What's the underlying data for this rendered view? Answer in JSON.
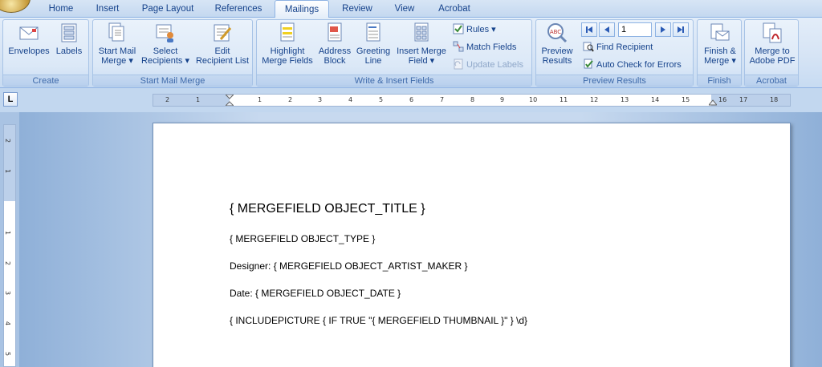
{
  "tabs": [
    "Home",
    "Insert",
    "Page Layout",
    "References",
    "Mailings",
    "Review",
    "View",
    "Acrobat"
  ],
  "active_tab": "Mailings",
  "ribbon": {
    "create": {
      "label": "Create",
      "envelopes": "Envelopes",
      "labels": "Labels"
    },
    "start_mail_merge": {
      "label": "Start Mail Merge",
      "start_l1": "Start Mail",
      "start_l2": "Merge ▾",
      "select_l1": "Select",
      "select_l2": "Recipients ▾",
      "edit_l1": "Edit",
      "edit_l2": "Recipient List"
    },
    "write_insert": {
      "label": "Write & Insert Fields",
      "highlight_l1": "Highlight",
      "highlight_l2": "Merge Fields",
      "address_l1": "Address",
      "address_l2": "Block",
      "greeting_l1": "Greeting",
      "greeting_l2": "Line",
      "insert_l1": "Insert Merge",
      "insert_l2": "Field ▾",
      "rules": "Rules ▾",
      "match_fields": "Match Fields",
      "update_labels": "Update Labels"
    },
    "preview": {
      "label": "Preview Results",
      "preview_l1": "Preview",
      "preview_l2": "Results",
      "record_value": "1",
      "find_recipient": "Find Recipient",
      "auto_check": "Auto Check for Errors"
    },
    "finish": {
      "label": "Finish",
      "finish_l1": "Finish &",
      "finish_l2": "Merge ▾"
    },
    "acrobat": {
      "label": "Acrobat",
      "merge_l1": "Merge to",
      "merge_l2": "Adobe PDF"
    }
  },
  "ruler": {
    "tab_selector": "L",
    "h_ticks": [
      "2",
      "1",
      "1",
      "2",
      "3",
      "4",
      "5",
      "6",
      "7",
      "8",
      "9",
      "10",
      "11",
      "12",
      "13",
      "14",
      "15",
      "16",
      "17",
      "18"
    ],
    "v_ticks": [
      "2",
      "1",
      "1",
      "2",
      "3",
      "4",
      "5"
    ]
  },
  "document": {
    "line1": "{ MERGEFIELD OBJECT_TITLE }",
    "line2": "{ MERGEFIELD  OBJECT_TYPE }",
    "line3": "Designer: { MERGEFIELD OBJECT_ARTIST_MAKER }",
    "line4": "Date: { MERGEFIELD  OBJECT_DATE }",
    "line5": "{ INCLUDEPICTURE { IF TRUE \"{ MERGEFIELD  THUMBNAIL }\" } \\d}"
  }
}
